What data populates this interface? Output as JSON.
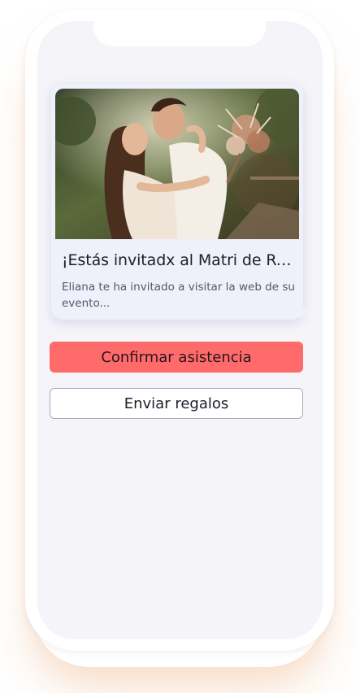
{
  "message_card": {
    "title": "¡Estás invitadx al Matri de Rod...",
    "description": "Eliana te ha invitado a visitar la web de su evento..."
  },
  "actions": {
    "confirm_label": "Confirmar asistencia",
    "gifts_label": "Enviar regalos"
  },
  "colors": {
    "primary_button": "#ff6b6b",
    "screen_background": "#f4f4f9",
    "card_background": "#eef0fa"
  }
}
